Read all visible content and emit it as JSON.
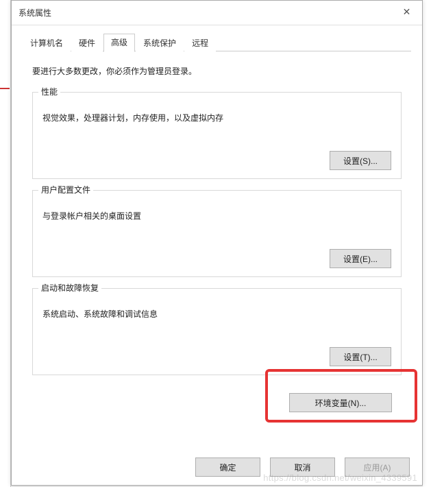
{
  "titlebar": {
    "title": "系统属性",
    "close_label": "✕"
  },
  "tabs": {
    "computer_name": "计算机名",
    "hardware": "硬件",
    "advanced": "高级",
    "system_protection": "系统保护",
    "remote": "远程"
  },
  "content": {
    "admin_msg": "要进行大多数更改，你必须作为管理员登录。",
    "performance": {
      "legend": "性能",
      "desc": "视觉效果，处理器计划，内存使用，以及虚拟内存",
      "button": "设置(S)..."
    },
    "user_profile": {
      "legend": "用户配置文件",
      "desc": "与登录帐户相关的桌面设置",
      "button": "设置(E)..."
    },
    "startup": {
      "legend": "启动和故障恢复",
      "desc": "系统启动、系统故障和调试信息",
      "button": "设置(T)..."
    },
    "env_var_button": "环境变量(N)..."
  },
  "footer": {
    "ok": "确定",
    "cancel": "取消",
    "apply": "应用(A)"
  },
  "watermark": "https://blog.csdn.net/weixin_4339591"
}
